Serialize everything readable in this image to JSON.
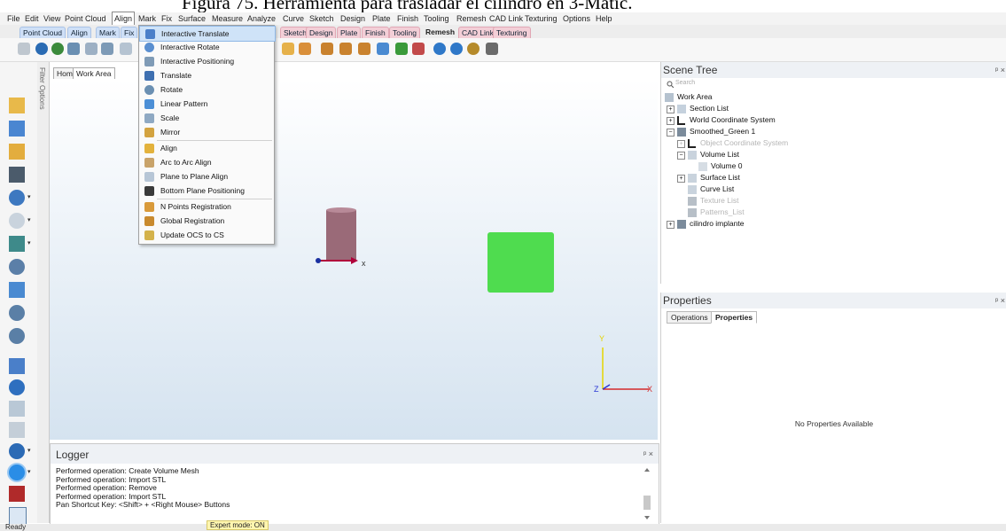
{
  "caption": "Figura 75. Herramienta para trasladar el cilindro en 3-Matic.",
  "menubar": [
    "File",
    "Edit",
    "View",
    "Point Cloud",
    "Align",
    "Mark",
    "Fix",
    "Surface",
    "Measure",
    "Analyze",
    "Curve",
    "Sketch",
    "Design",
    "Plate",
    "Finish",
    "Tooling",
    "Remesh",
    "CAD Link",
    "Texturing",
    "Options",
    "Help"
  ],
  "ribbon_tabs": [
    "Point Cloud",
    "Align",
    "Mark",
    "Fix",
    "Sketch",
    "Design",
    "Plate",
    "Finish",
    "Tooling",
    "Remesh",
    "CAD Link",
    "Texturing"
  ],
  "filter_options": "Filter Options",
  "viewport_tabs": [
    "Home",
    "Work Area"
  ],
  "align_menu": {
    "items": [
      {
        "label": "Interactive Translate",
        "icon": "translate-arrows-icon",
        "highlighted": true
      },
      {
        "label": "Interactive Rotate",
        "icon": "rotate-icon"
      },
      {
        "label": "Interactive Positioning",
        "icon": "positioning-icon"
      },
      {
        "label": "Translate",
        "icon": "translate-icon"
      },
      {
        "label": "Rotate",
        "icon": "rotate-icon"
      },
      {
        "label": "Linear Pattern",
        "icon": "linear-pattern-icon"
      },
      {
        "label": "Scale",
        "icon": "scale-icon"
      },
      {
        "label": "Mirror",
        "icon": "mirror-icon"
      },
      {
        "label": "Align",
        "icon": "align-icon"
      },
      {
        "label": "Arc to Arc Align",
        "icon": "arc-align-icon"
      },
      {
        "label": "Plane to Plane Align",
        "icon": "plane-align-icon"
      },
      {
        "label": "Bottom Plane Positioning",
        "icon": "bottom-plane-icon"
      },
      {
        "label": "N Points Registration",
        "icon": "n-points-icon"
      },
      {
        "label": "Global Registration",
        "icon": "global-registration-icon"
      },
      {
        "label": "Update OCS to CS",
        "icon": "update-ocs-icon"
      }
    ]
  },
  "viewport": {
    "axis_x": "x",
    "axis_y": "Y",
    "axis_z": "Z",
    "axis_x2": "X",
    "cube_color": "#4fdc4f",
    "cylinder_color": "#9a6a78"
  },
  "logger": {
    "title": "Logger",
    "pin": " \u0001 ×",
    "lines": [
      "Performed operation: Create Volume Mesh",
      "Performed operation: Import STL",
      "Performed operation: Remove",
      "Performed operation: Import STL",
      "Pan Shortcut Key: <Shift> + <Right Mouse> Buttons"
    ]
  },
  "status": {
    "ready": "Ready",
    "expert": "Expert mode: ON"
  },
  "scene_tree": {
    "title": "Scene Tree",
    "search_placeholder": "Search",
    "nodes": [
      {
        "label": "Work Area",
        "dim": false
      },
      {
        "label": "Section List",
        "dim": false
      },
      {
        "label": "World Coordinate System",
        "dim": false
      },
      {
        "label": "Smoothed_Green 1",
        "dim": false
      },
      {
        "label": "Object Coordinate System",
        "dim": true
      },
      {
        "label": "Volume List",
        "dim": false
      },
      {
        "label": "Volume 0",
        "dim": false
      },
      {
        "label": "Surface List",
        "dim": false
      },
      {
        "label": "Curve List",
        "dim": false
      },
      {
        "label": "Texture List",
        "dim": true
      },
      {
        "label": "Patterns_List",
        "dim": true
      },
      {
        "label": "cilindro implante",
        "dim": false
      }
    ]
  },
  "properties": {
    "title": "Properties",
    "tabs": [
      "Operations",
      "Properties"
    ],
    "empty": "No Properties Available"
  }
}
